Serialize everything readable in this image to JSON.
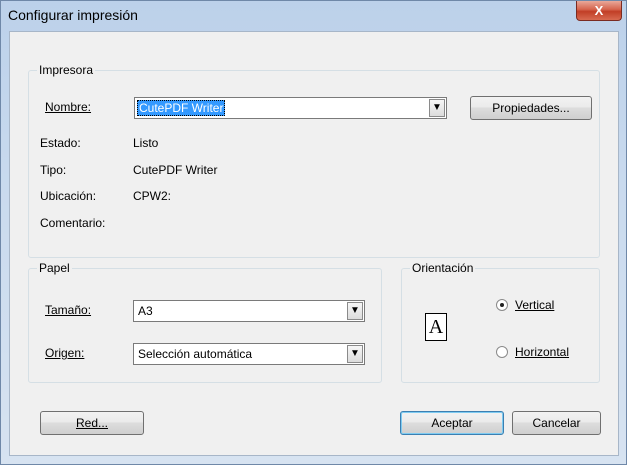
{
  "window": {
    "title": "Configurar impresión",
    "close_glyph": "X"
  },
  "printer": {
    "group_title": "Impresora",
    "name_label": "Nombre:",
    "name_value": "CutePDF Writer",
    "properties_button": "Propiedades...",
    "status_label": "Estado:",
    "status_value": "Listo",
    "type_label": "Tipo:",
    "type_value": "CutePDF Writer",
    "location_label": "Ubicación:",
    "location_value": "CPW2:",
    "comment_label": "Comentario:"
  },
  "paper": {
    "group_title": "Papel",
    "size_label": "Tamaño:",
    "size_value": "A3",
    "source_label": "Origen:",
    "source_value": "Selección automática"
  },
  "orientation": {
    "group_title": "Orientación",
    "icon_letter": "A",
    "vertical_label": "Vertical",
    "horizontal_label": "Horizontal",
    "selected": "Vertical"
  },
  "buttons": {
    "network": "Red...",
    "ok": "Aceptar",
    "cancel": "Cancelar"
  },
  "icons": {
    "dropdown": "chevron-down-icon"
  }
}
